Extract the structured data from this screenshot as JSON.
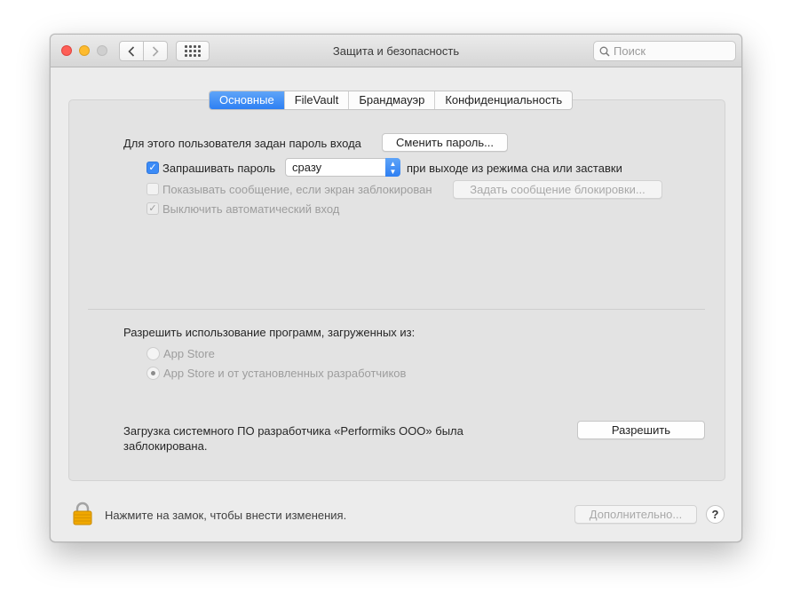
{
  "window": {
    "title": "Защита и безопасность",
    "search_placeholder": "Поиск"
  },
  "tabs": [
    {
      "label": "Основные",
      "active": true
    },
    {
      "label": "FileVault",
      "active": false
    },
    {
      "label": "Брандмауэр",
      "active": false
    },
    {
      "label": "Конфиденциальность",
      "active": false
    }
  ],
  "general": {
    "password_text": "Для этого пользователя задан пароль входа",
    "change_password_button": "Сменить пароль...",
    "require_password_label": "Запрашивать пароль",
    "require_password_checked": true,
    "require_password_select": "сразу",
    "require_password_suffix": "при выходе из режима сна или заставки",
    "show_message_label": "Показывать сообщение, если экран заблокирован",
    "show_message_checked": false,
    "set_lock_message_button": "Задать сообщение блокировки...",
    "disable_autologin_label": "Выключить автоматический вход",
    "disable_autologin_checked": true
  },
  "apps": {
    "heading": "Разрешить использование программ, загруженных из:",
    "options": [
      {
        "label": "App Store",
        "selected": false
      },
      {
        "label": "App Store и от установленных разработчиков",
        "selected": true
      }
    ]
  },
  "blocked": {
    "line1": "Загрузка системного ПО разработчика «Performiks OOO» была",
    "line2": "заблокирована.",
    "allow_button": "Разрешить"
  },
  "footer": {
    "lock_text": "Нажмите на замок, чтобы внести изменения.",
    "advanced_button": "Дополнительно...",
    "help_label": "?"
  },
  "icons": {
    "back": "chevron-left-icon",
    "forward": "chevron-right-icon",
    "grid": "grid-icon",
    "search": "magnifier-icon",
    "lock": "lock-icon"
  },
  "colors": {
    "accent": "#2d7ff3",
    "close": "#fe5f57",
    "minimize": "#febb2e",
    "lock": "#f0a800"
  }
}
